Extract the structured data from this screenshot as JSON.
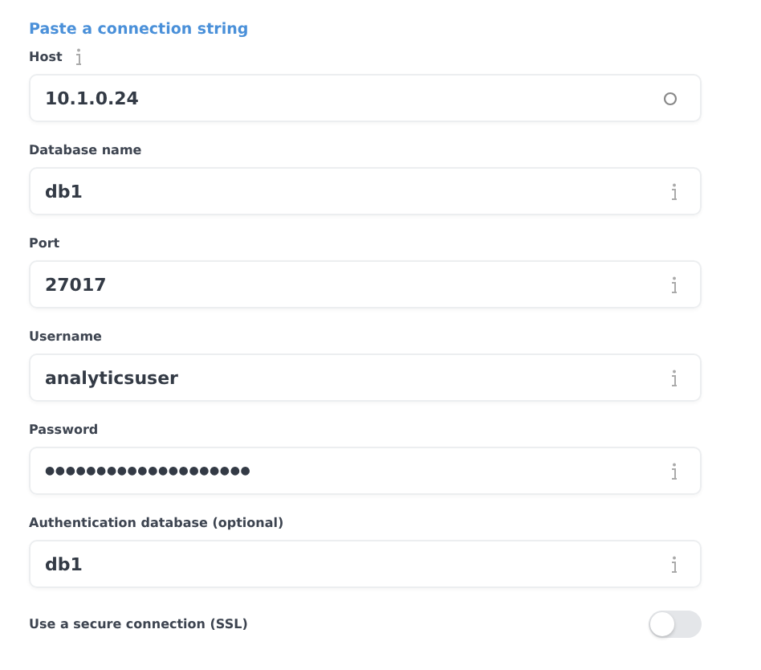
{
  "link": "Paste a connection string",
  "fields": [
    {
      "label": "Host",
      "value": "10.1.0.24",
      "kind": "host"
    },
    {
      "label": "Database name",
      "value": "db1",
      "kind": "text"
    },
    {
      "label": "Port",
      "value": "27017",
      "kind": "text"
    },
    {
      "label": "Username",
      "value": "analyticsuser",
      "kind": "text"
    },
    {
      "label": "Password",
      "value": "●●●●●●●●●●●●●●●●●●●●",
      "kind": "password"
    },
    {
      "label": "Authentication database (optional)",
      "value": "db1",
      "kind": "text"
    }
  ],
  "ssl": {
    "label": "Use a secure connection (SSL)",
    "on": false
  }
}
